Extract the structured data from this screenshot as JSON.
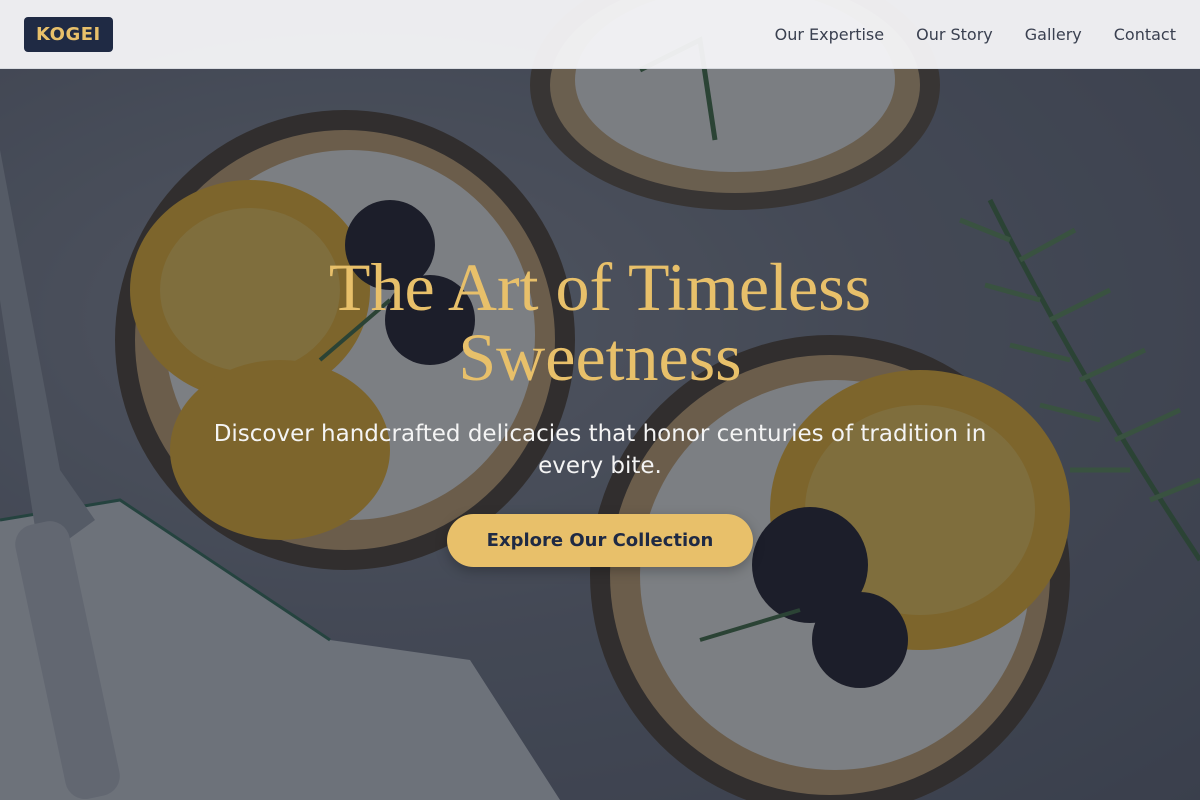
{
  "brand": {
    "logo_text": "KOGEI",
    "logo_color": "#e8c06a",
    "logo_bg": "#1f2a44"
  },
  "nav": {
    "links": [
      {
        "label": "Our Expertise"
      },
      {
        "label": "Our Story"
      },
      {
        "label": "Gallery"
      },
      {
        "label": "Contact"
      }
    ]
  },
  "hero": {
    "title": "The Art of Timeless Sweetness",
    "subtitle": "Discover handcrafted delicacies that honor centuries of tradition in every bite.",
    "cta_label": "Explore Our Collection",
    "accent_color": "#e8c06a",
    "background_image": "tarts-with-orange-slices-blackberries-rosemary"
  }
}
